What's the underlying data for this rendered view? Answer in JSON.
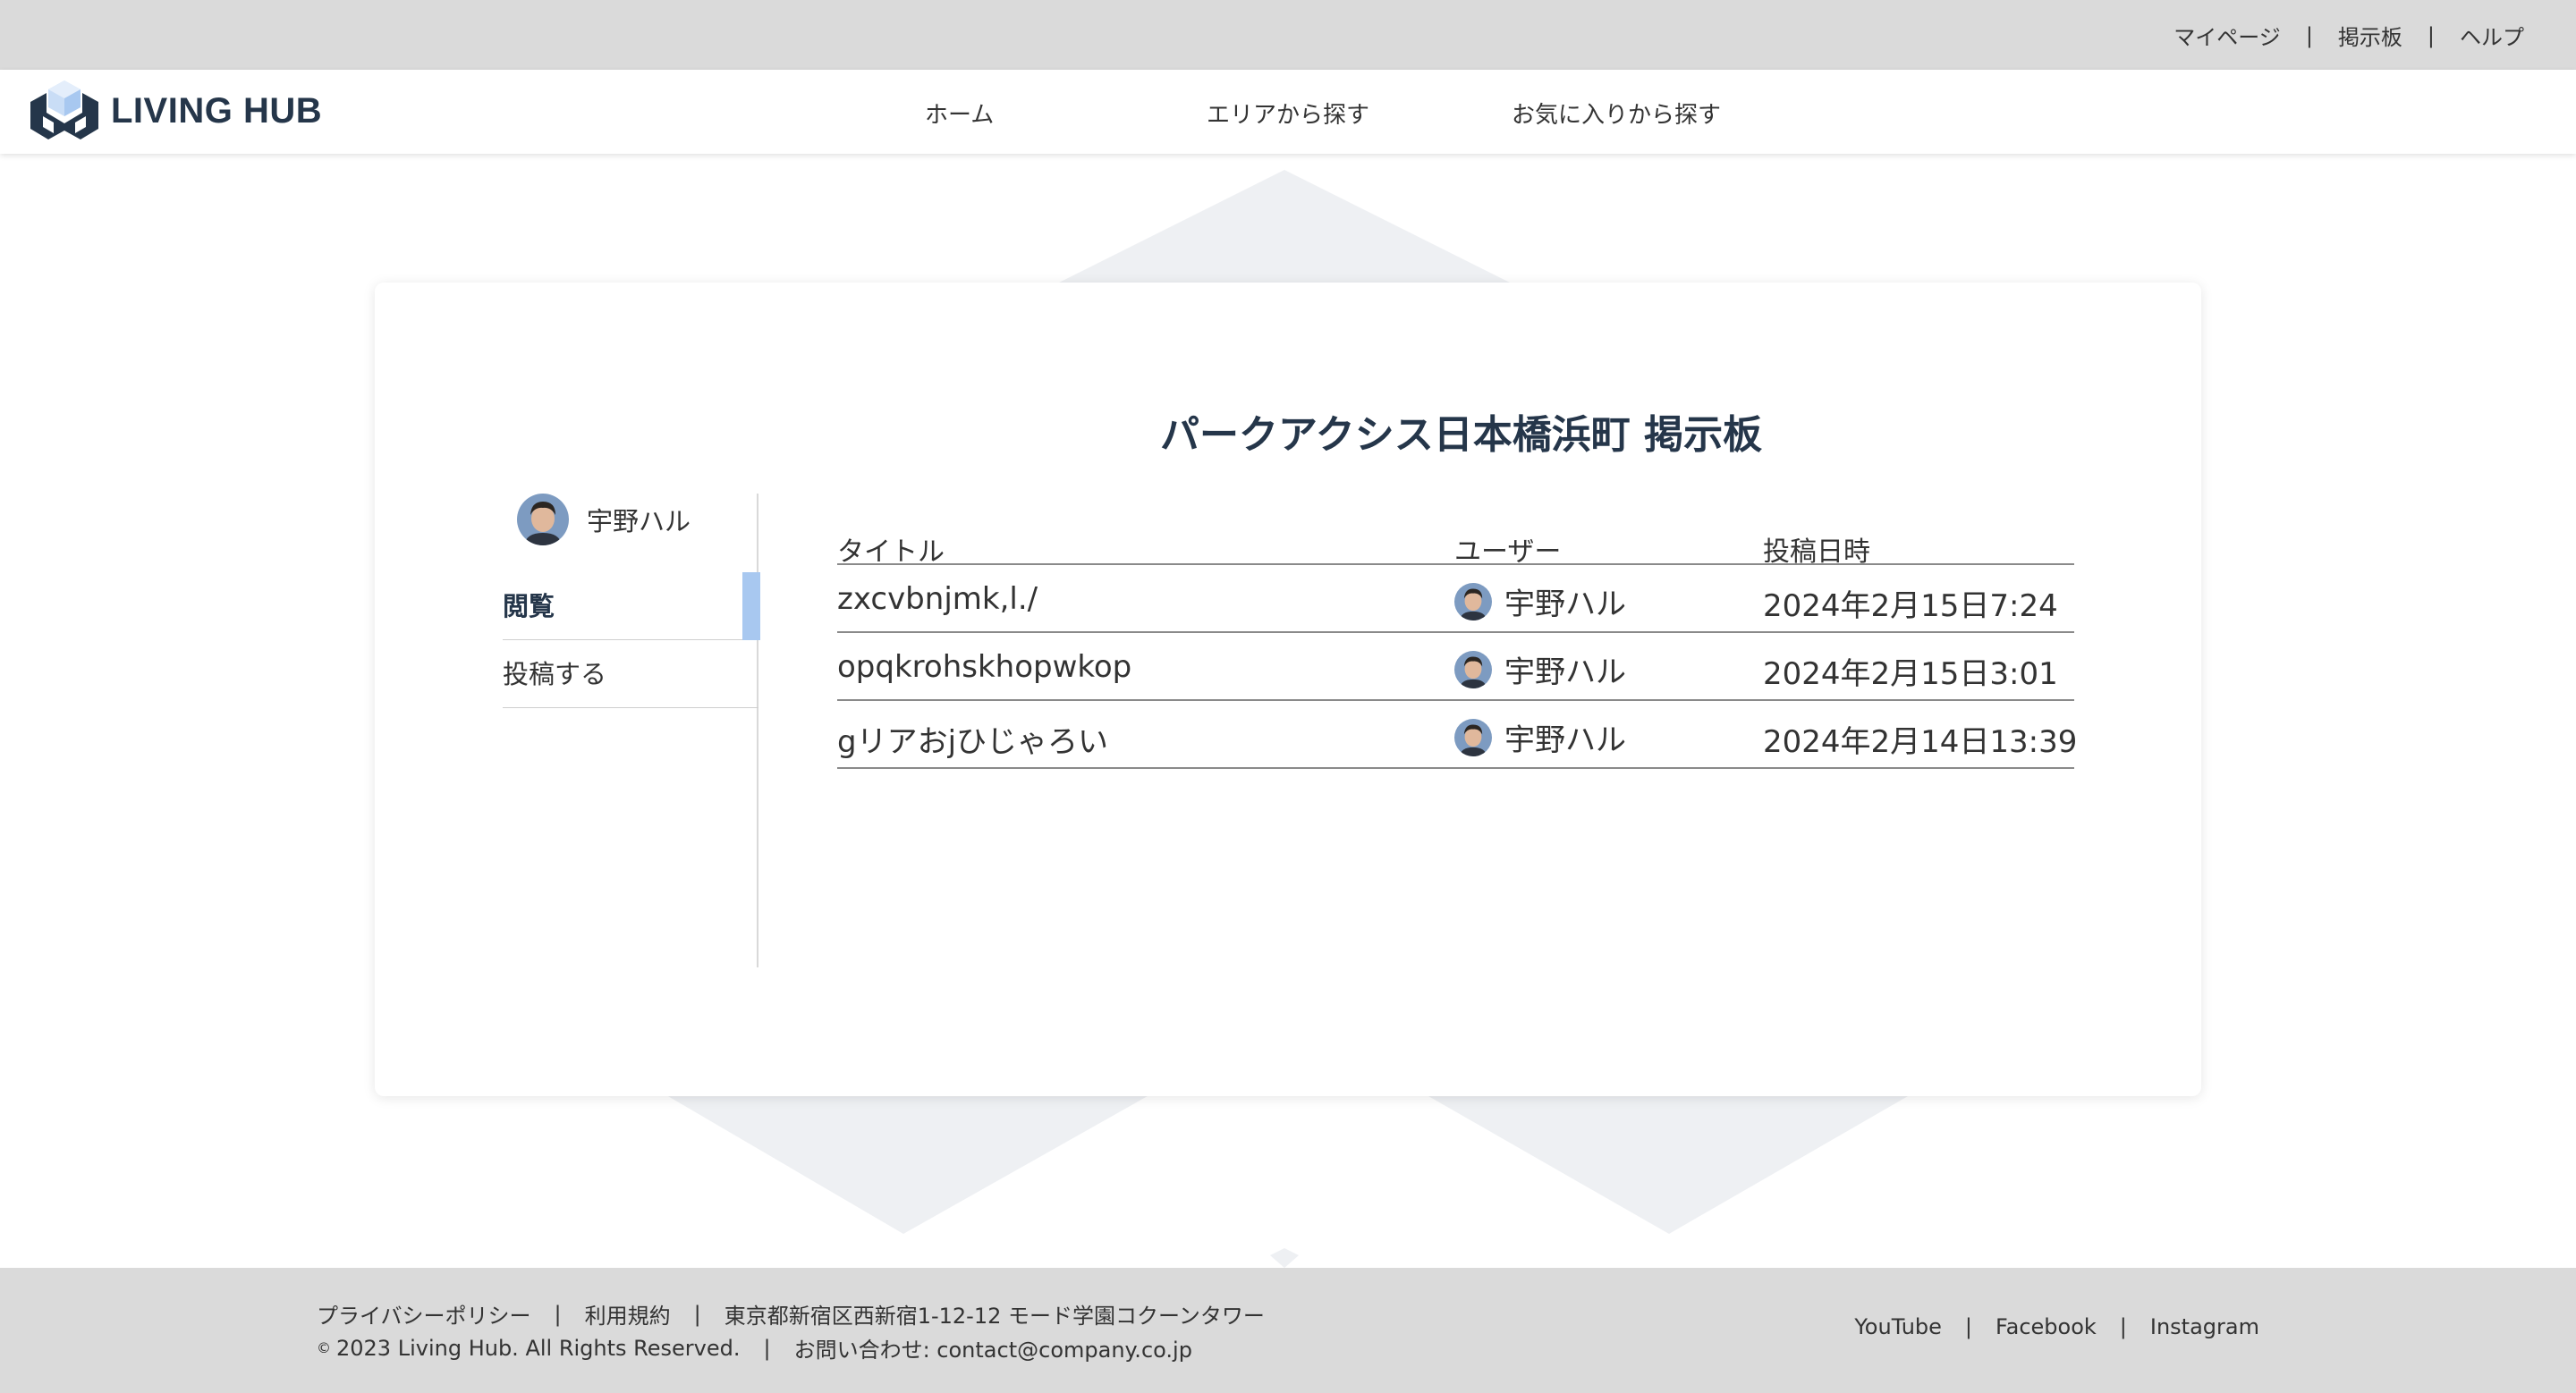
{
  "top_links": {
    "mypage": "マイページ",
    "board": "掲示板",
    "help": "ヘルプ",
    "separator": "|"
  },
  "header": {
    "logo_text": "LIVING HUB",
    "nav": {
      "home": "ホーム",
      "area": "エリアから探す",
      "favorites": "お気に入りから探す"
    }
  },
  "board": {
    "title": "パークアクシス日本橋浜町 掲示板"
  },
  "sidebar": {
    "user_name": "宇野ハル",
    "menu": {
      "browse": "閲覧",
      "post": "投稿する"
    }
  },
  "table": {
    "headers": {
      "title": "タイトル",
      "user": "ユーザー",
      "date": "投稿日時"
    },
    "rows": [
      {
        "title": "zxcvbnjmk,l./",
        "user": "宇野ハル",
        "date": "2024年2月15日7:24"
      },
      {
        "title": "opqkrohskhopwkop",
        "user": "宇野ハル",
        "date": "2024年2月15日3:01"
      },
      {
        "title": "gリアおjひじゃろい",
        "user": "宇野ハル",
        "date": "2024年2月14日13:39"
      }
    ]
  },
  "footer": {
    "privacy": "プライバシーポリシー",
    "terms": "利用規約",
    "address": "東京都新宿区西新宿1-12-12 モード学園コクーンタワー",
    "copyright_symbol": "©",
    "copyright": "2023 Living Hub. All Rights Reserved.",
    "contact": "お問い合わせ: contact@company.co.jp",
    "separator": "|",
    "social": {
      "youtube": "YouTube",
      "facebook": "Facebook",
      "instagram": "Instagram"
    }
  },
  "colors": {
    "topbar_bg": "#dadada",
    "brand_text": "#25364a",
    "active_indicator": "#a8c8f0",
    "logo_dark": "#25364a",
    "logo_light": "#a8c8f0"
  }
}
